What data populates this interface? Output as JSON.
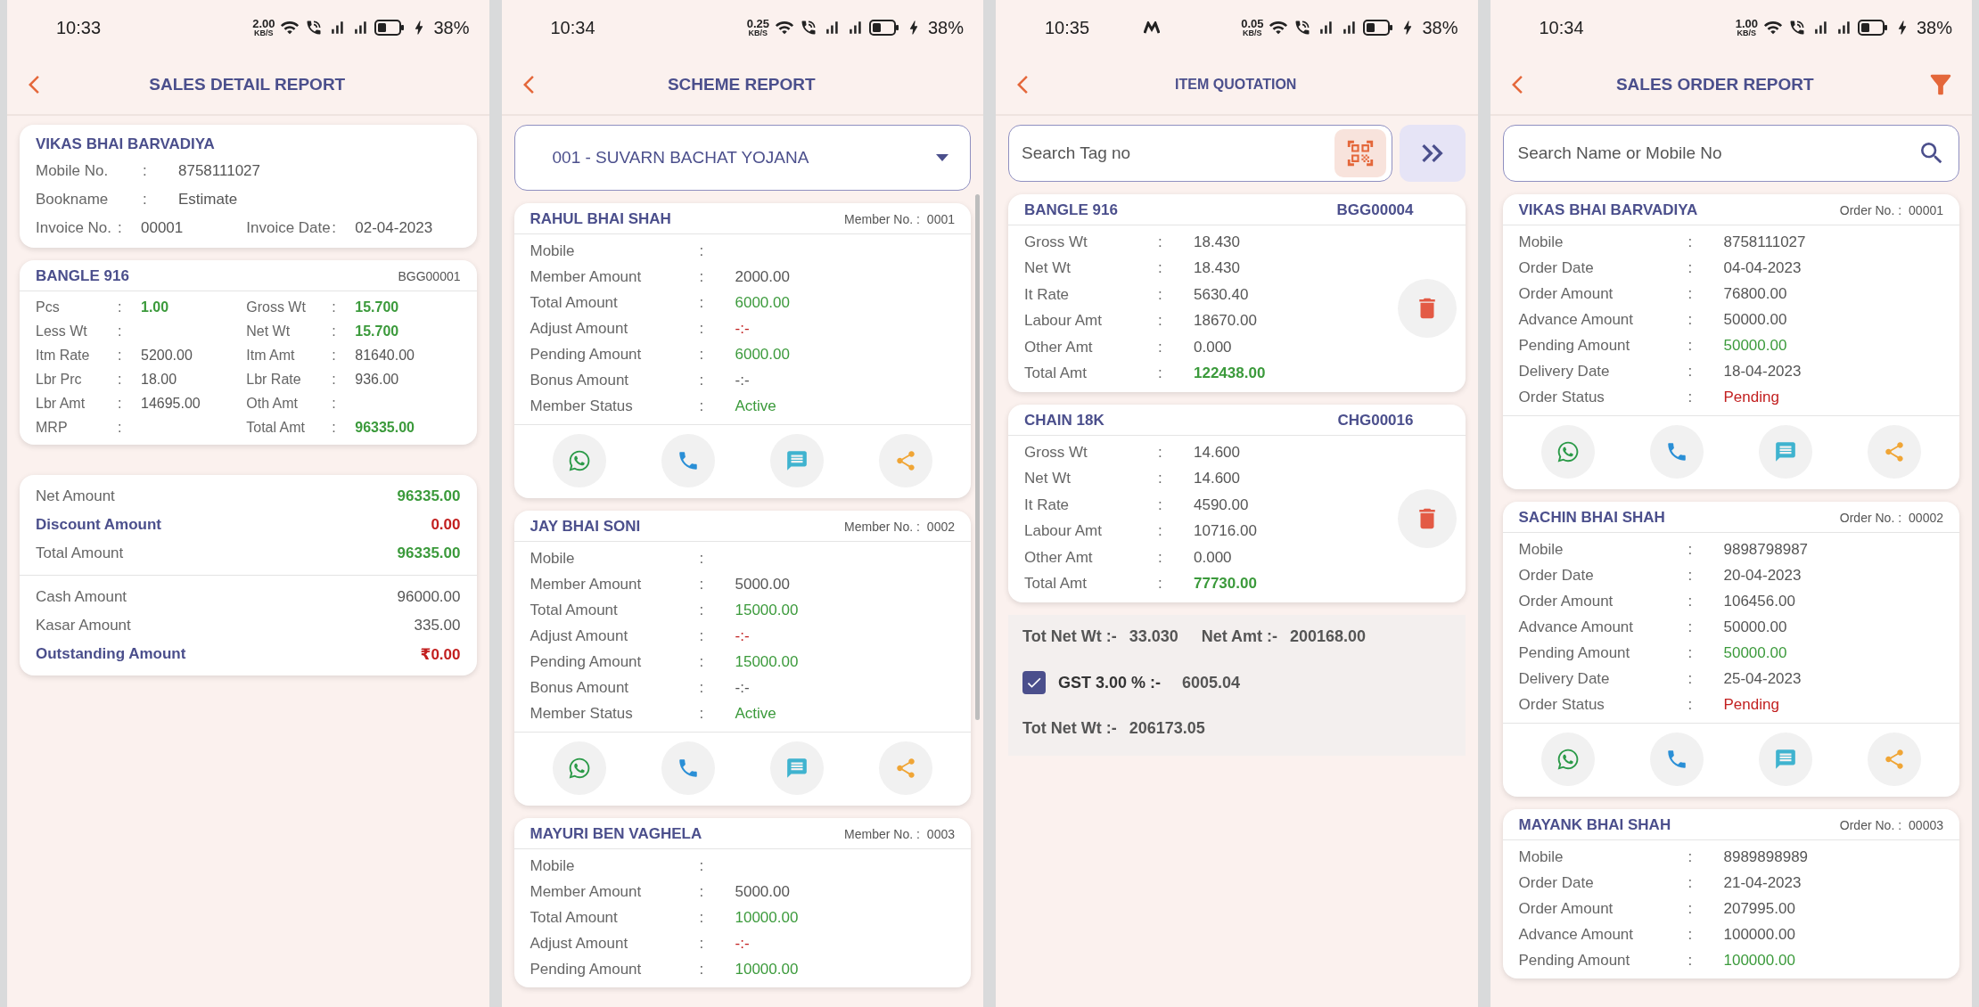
{
  "screens": [
    {
      "kind": "sales_detail",
      "status": {
        "time": "10:33",
        "speed": "2.00",
        "speed_unit": "KB/S",
        "battery": "38%"
      },
      "title": "SALES DETAIL REPORT",
      "customer": {
        "name": "VIKAS BHAI BARVADIYA",
        "rows": [
          {
            "label": "Mobile No.",
            "sep": ":",
            "value": "8758111027"
          },
          {
            "label": "Bookname",
            "sep": ":",
            "value": "Estimate"
          }
        ],
        "invoice": [
          {
            "label": "Invoice No.",
            "sep": ":",
            "value": "00001"
          },
          {
            "label": "Invoice Date",
            "sep": ":",
            "value": "02-04-2023"
          }
        ]
      },
      "item": {
        "name": "BANGLE 916",
        "code": "BGG00001",
        "rows": [
          [
            {
              "label": "Pcs",
              "sep": ":",
              "value": "1.00",
              "color": "#3b9a3b"
            },
            {
              "label": "Gross Wt",
              "sep": ":",
              "value": "15.700",
              "color": "#3b9a3b"
            }
          ],
          [
            {
              "label": "Less Wt",
              "sep": ":"
            },
            {
              "label": "Net Wt",
              "sep": ":",
              "value": "15.700",
              "color": "#3b9a3b"
            }
          ],
          [
            {
              "label": "Itm Rate",
              "sep": ":",
              "value": "5200.00",
              "color": "#555555"
            },
            {
              "label": "Itm Amt",
              "sep": ":",
              "value": "81640.00",
              "color": "#555555"
            }
          ],
          [
            {
              "label": "Lbr Prc",
              "sep": ":",
              "value": "18.00",
              "color": "#555555"
            },
            {
              "label": "Lbr Rate",
              "sep": ":",
              "value": "936.00",
              "color": "#555555"
            }
          ],
          [
            {
              "label": "Lbr Amt",
              "sep": ":",
              "value": "14695.00",
              "color": "#555555"
            },
            {
              "label": "Oth Amt",
              "sep": ":"
            }
          ],
          [
            {
              "label": "MRP",
              "sep": ":"
            },
            {
              "label": "Total Amt",
              "sep": ":",
              "value": "96335.00",
              "color": "#3b9a3b"
            }
          ]
        ]
      },
      "summary": [
        [
          {
            "label": "Net Amount",
            "value": "96335.00",
            "color": "#3b9a3b",
            "emphasis": false
          },
          {
            "label": "Discount Amount",
            "value": "0.00",
            "color": "#c21f1f",
            "emphasis": true
          },
          {
            "label": "Total Amount",
            "value": "96335.00",
            "color": "#3b9a3b",
            "emphasis": false
          }
        ],
        [
          {
            "label": "Cash Amount",
            "value": "96000.00",
            "color": "#555555",
            "emphasis": false
          },
          {
            "label": "Kasar Amount",
            "value": "335.00",
            "color": "#555555",
            "emphasis": false
          },
          {
            "label": "Outstanding Amount",
            "value": "₹0.00",
            "color": "#c21f1f",
            "emphasis": true
          }
        ]
      ]
    },
    {
      "kind": "scheme",
      "status": {
        "time": "10:34",
        "speed": "0.25",
        "speed_unit": "KB/S",
        "battery": "38%"
      },
      "title": "SCHEME REPORT",
      "dropdown": "001 - SUVARN BACHAT YOJANA",
      "members": [
        {
          "name": "RAHUL BHAI SHAH",
          "number_label": "Member No. :",
          "number": "0001",
          "actions": true,
          "rows": [
            {
              "label": "Mobile",
              "sep": ":"
            },
            {
              "label": "Member Amount",
              "sep": ":",
              "value": "2000.00",
              "color": "#555555"
            },
            {
              "label": "Total Amount",
              "sep": ":",
              "value": "6000.00",
              "color": "#3b9a3b"
            },
            {
              "label": "Adjust Amount",
              "sep": ":",
              "value": "-:-",
              "color": "#c21f1f"
            },
            {
              "label": "Pending Amount",
              "sep": ":",
              "value": "6000.00",
              "color": "#3b9a3b"
            },
            {
              "label": "Bonus Amount",
              "sep": ":",
              "value": "-:-",
              "color": "#555555"
            },
            {
              "label": "Member Status",
              "sep": ":",
              "value": "Active",
              "color": "#3b9a3b"
            }
          ]
        },
        {
          "name": "JAY BHAI SONI",
          "number_label": "Member No. :",
          "number": "0002",
          "actions": true,
          "rows": [
            {
              "label": "Mobile",
              "sep": ":"
            },
            {
              "label": "Member Amount",
              "sep": ":",
              "value": "5000.00",
              "color": "#555555"
            },
            {
              "label": "Total Amount",
              "sep": ":",
              "value": "15000.00",
              "color": "#3b9a3b"
            },
            {
              "label": "Adjust Amount",
              "sep": ":",
              "value": "-:-",
              "color": "#c21f1f"
            },
            {
              "label": "Pending Amount",
              "sep": ":",
              "value": "15000.00",
              "color": "#3b9a3b"
            },
            {
              "label": "Bonus Amount",
              "sep": ":",
              "value": "-:-",
              "color": "#555555"
            },
            {
              "label": "Member Status",
              "sep": ":",
              "value": "Active",
              "color": "#3b9a3b"
            }
          ]
        },
        {
          "name": "MAYURI BEN VAGHELA",
          "number_label": "Member No. :",
          "number": "0003",
          "actions": false,
          "rows": [
            {
              "label": "Mobile",
              "sep": ":"
            },
            {
              "label": "Member Amount",
              "sep": ":",
              "value": "5000.00",
              "color": "#555555"
            },
            {
              "label": "Total Amount",
              "sep": ":",
              "value": "10000.00",
              "color": "#3b9a3b"
            },
            {
              "label": "Adjust Amount",
              "sep": ":",
              "value": "-:-",
              "color": "#c21f1f"
            },
            {
              "label": "Pending Amount",
              "sep": ":",
              "value": "10000.00",
              "color": "#3b9a3b"
            }
          ]
        }
      ]
    },
    {
      "kind": "quotation",
      "status": {
        "time": "10:35",
        "speed": "0.05",
        "speed_unit": "KB/S",
        "battery": "38%",
        "app_icon": true
      },
      "title": "ITEM QUOTATION",
      "search": {
        "placeholder": "Search Tag no"
      },
      "items": [
        {
          "name": "BANGLE 916",
          "code": "BGG00004",
          "rows": [
            {
              "label": "Gross Wt",
              "sep": ":",
              "value": "18.430",
              "color": "#555555"
            },
            {
              "label": "Net Wt",
              "sep": ":",
              "value": "18.430",
              "color": "#555555"
            },
            {
              "label": "It Rate",
              "sep": ":",
              "value": "5630.40",
              "color": "#555555"
            },
            {
              "label": "Labour Amt",
              "sep": ":",
              "value": "18670.00",
              "color": "#555555"
            },
            {
              "label": "Other Amt",
              "sep": ":",
              "value": "0.000",
              "color": "#555555"
            },
            {
              "label": "Total Amt",
              "sep": ":",
              "value": "122438.00",
              "color": "#3b9a3b"
            }
          ]
        },
        {
          "name": "CHAIN 18K",
          "code": "CHG00016",
          "rows": [
            {
              "label": "Gross Wt",
              "sep": ":",
              "value": "14.600",
              "color": "#555555"
            },
            {
              "label": "Net Wt",
              "sep": ":",
              "value": "14.600",
              "color": "#555555"
            },
            {
              "label": "It Rate",
              "sep": ":",
              "value": "4590.00",
              "color": "#555555"
            },
            {
              "label": "Labour Amt",
              "sep": ":",
              "value": "10716.00",
              "color": "#555555"
            },
            {
              "label": "Other Amt",
              "sep": ":",
              "value": "0.000",
              "color": "#555555"
            },
            {
              "label": "Total Amt",
              "sep": ":",
              "value": "77730.00",
              "color": "#3b9a3b"
            }
          ]
        }
      ],
      "totals": {
        "net_wt_label": "Tot Net Wt :-",
        "net_wt": "33.030",
        "net_amt_label": "Net Amt :-",
        "net_amt": "200168.00",
        "gst": {
          "checked": true,
          "label": "GST 3.00 % :-",
          "value": "6005.04"
        },
        "final_label": "Tot Net Wt :-",
        "final": "206173.05"
      }
    },
    {
      "kind": "sales_order",
      "status": {
        "time": "10:34",
        "speed": "1.00",
        "speed_unit": "KB/S",
        "battery": "38%"
      },
      "title": "SALES ORDER REPORT",
      "filter": true,
      "search": {
        "placeholder": "Search Name or Mobile No"
      },
      "orders": [
        {
          "name": "VIKAS BHAI BARVADIYA",
          "number_label": "Order No. :",
          "number": "00001",
          "actions": true,
          "rows": [
            {
              "label": "Mobile",
              "sep": ":",
              "value": "8758111027",
              "color": "#555555"
            },
            {
              "label": "Order Date",
              "sep": ":",
              "value": "04-04-2023",
              "color": "#555555"
            },
            {
              "label": "Order Amount",
              "sep": ":",
              "value": "76800.00",
              "color": "#555555"
            },
            {
              "label": "Advance Amount",
              "sep": ":",
              "value": "50000.00",
              "color": "#555555"
            },
            {
              "label": "Pending Amount",
              "sep": ":",
              "value": "50000.00",
              "color": "#3b9a3b"
            },
            {
              "label": "Delivery Date",
              "sep": ":",
              "value": "18-04-2023",
              "color": "#555555"
            },
            {
              "label": "Order Status",
              "sep": ":",
              "value": "Pending",
              "color": "#c21f1f"
            }
          ]
        },
        {
          "name": "SACHIN BHAI SHAH",
          "number_label": "Order No. :",
          "number": "00002",
          "actions": true,
          "rows": [
            {
              "label": "Mobile",
              "sep": ":",
              "value": "9898798987",
              "color": "#555555"
            },
            {
              "label": "Order Date",
              "sep": ":",
              "value": "20-04-2023",
              "color": "#555555"
            },
            {
              "label": "Order Amount",
              "sep": ":",
              "value": "106456.00",
              "color": "#555555"
            },
            {
              "label": "Advance Amount",
              "sep": ":",
              "value": "50000.00",
              "color": "#555555"
            },
            {
              "label": "Pending Amount",
              "sep": ":",
              "value": "50000.00",
              "color": "#3b9a3b"
            },
            {
              "label": "Delivery Date",
              "sep": ":",
              "value": "25-04-2023",
              "color": "#555555"
            },
            {
              "label": "Order Status",
              "sep": ":",
              "value": "Pending",
              "color": "#c21f1f"
            }
          ]
        },
        {
          "name": "MAYANK BHAI SHAH",
          "number_label": "Order No. :",
          "number": "00003",
          "actions": false,
          "rows": [
            {
              "label": "Mobile",
              "sep": ":",
              "value": "8989898989",
              "color": "#555555"
            },
            {
              "label": "Order Date",
              "sep": ":",
              "value": "21-04-2023",
              "color": "#555555"
            },
            {
              "label": "Order Amount",
              "sep": ":",
              "value": "207995.00",
              "color": "#555555"
            },
            {
              "label": "Advance Amount",
              "sep": ":",
              "value": "100000.00",
              "color": "#555555"
            },
            {
              "label": "Pending Amount",
              "sep": ":",
              "value": "100000.00",
              "color": "#3b9a3b"
            }
          ]
        }
      ]
    }
  ]
}
